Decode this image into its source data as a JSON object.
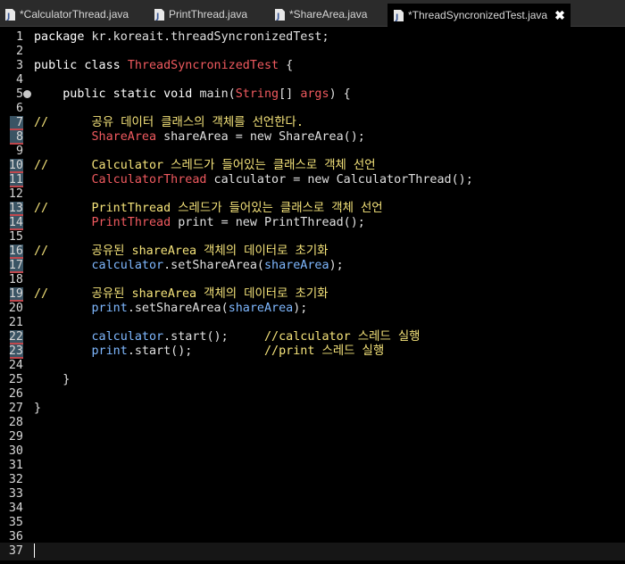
{
  "tabs": [
    {
      "label": "*CalculatorThread.java"
    },
    {
      "label": "PrintThread.java"
    },
    {
      "label": "*ShareArea.java"
    },
    {
      "label": "*ThreadSyncronizedTest.java",
      "close": "✖"
    }
  ],
  "line_numbers": [
    "1",
    "2",
    "3",
    "4",
    "5",
    "6",
    "7",
    "8",
    "9",
    "10",
    "11",
    "12",
    "13",
    "14",
    "15",
    "16",
    "17",
    "18",
    "19",
    "20",
    "21",
    "22",
    "23",
    "24",
    "25",
    "26",
    "27",
    "28",
    "29",
    "30",
    "31",
    "32",
    "33",
    "34",
    "35",
    "36",
    "37"
  ],
  "code": {
    "l1_a": "package",
    "l1_b": " kr.koreait.threadSyncronizedTest;",
    "l3_a": "public class ",
    "l3_b": "ThreadSyncronizedTest",
    "l3_c": " {",
    "l5_a": "    public static void ",
    "l5_b": "main(",
    "l5_c": "String",
    "l5_d": "[] ",
    "l5_e": "args",
    "l5_f": ") {",
    "l7_a": "//      ",
    "l7_b": "공유 데이터 클래스의 객체를 선언한다.",
    "l8_a": "        ",
    "l8_b": "ShareArea",
    "l8_c": " shareArea = new ShareArea();",
    "l10_a": "//      ",
    "l10_b": "Calculator 스레드가 들어있는 클래스로 객체 선언",
    "l11_a": "        ",
    "l11_b": "CalculatorThread",
    "l11_c": " calculator = new CalculatorThread();",
    "l13_a": "//      ",
    "l13_b": "PrintThread 스레드가 들어있는 클래스로 객체 선언",
    "l14_a": "        ",
    "l14_b": "PrintThread",
    "l14_c": " print = new PrintThread();",
    "l16_a": "//      ",
    "l16_b": "공유된 shareArea 객체의 데이터로 초기화",
    "l17_a": "        ",
    "l17_b": "calculator",
    "l17_c": ".setShareArea(",
    "l17_d": "shareArea",
    "l17_e": ");",
    "l19_a": "//      ",
    "l19_b": "공유된 shareArea 객체의 데이터로 초기화",
    "l20_a": "        ",
    "l20_b": "print",
    "l20_c": ".setShareArea(",
    "l20_d": "shareArea",
    "l20_e": ");",
    "l22_a": "        ",
    "l22_b": "calculator",
    "l22_c": ".start();     ",
    "l22_d": "//calculator 스레드 실행",
    "l23_a": "        ",
    "l23_b": "print",
    "l23_c": ".start();          ",
    "l23_d": "//print 스레드 실행",
    "l25": "    }",
    "l27": "}"
  },
  "marked_lines": [
    7,
    8,
    10,
    11,
    13,
    14,
    16,
    17,
    19,
    22,
    23
  ],
  "colors": {
    "background": "#000000",
    "keyword": "#ffffff",
    "type": "#f05a5f",
    "variable": "#7fb8ff",
    "comment": "#f5e37a"
  },
  "icons": [
    "java-file-icon",
    "fold-marker-icon",
    "close-icon"
  ]
}
